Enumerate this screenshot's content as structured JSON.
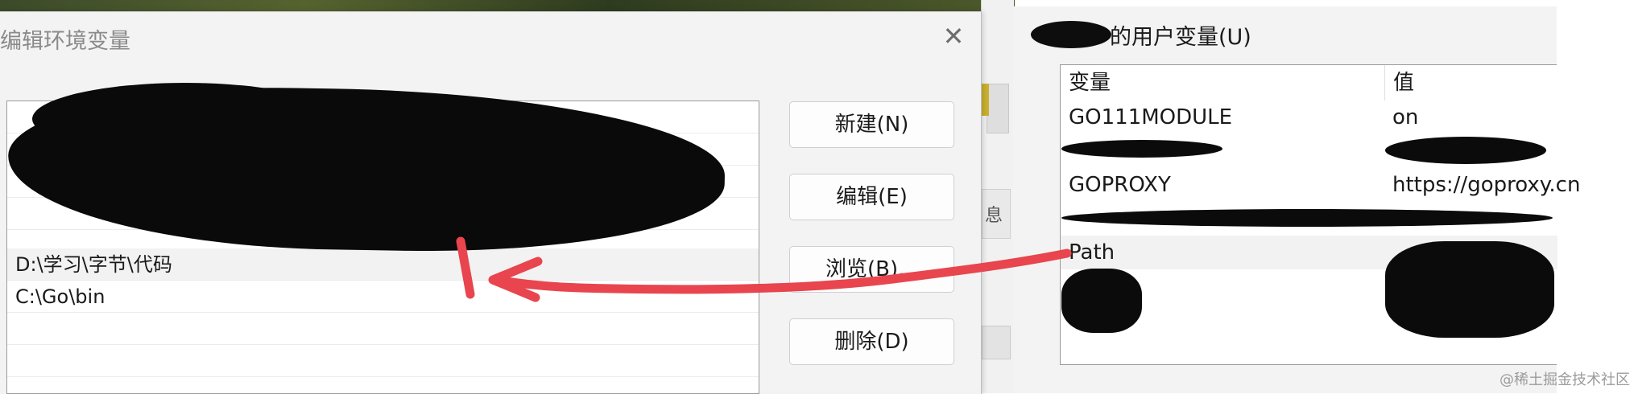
{
  "edit_dialog": {
    "title": "编辑环境变量",
    "close_glyph": "✕",
    "path_entries": [
      {
        "text": "D:\\学习\\字节\\代码",
        "selected": true
      },
      {
        "text": "C:\\Go\\bin",
        "selected": false
      }
    ],
    "buttons": {
      "new": "新建(N)",
      "edit": "编辑(E)",
      "browse": "浏览(B)...",
      "delete": "删除(D)"
    }
  },
  "user_vars_dialog": {
    "heading": "的用户变量(U)",
    "columns": {
      "name": "变量",
      "value": "值"
    },
    "rows": [
      {
        "name": "GO111MODULE",
        "value": "on"
      },
      {
        "name": "",
        "value": ""
      },
      {
        "name": "GOPROXY",
        "value": "https://goproxy.cn"
      },
      {
        "name": "",
        "value": ""
      },
      {
        "name": "Path",
        "value": ""
      }
    ]
  },
  "background": {
    "partial_glyph": "息"
  },
  "annotation": {
    "arrow_color": "#e8454e"
  },
  "watermark": "@稀土掘金技术社区"
}
